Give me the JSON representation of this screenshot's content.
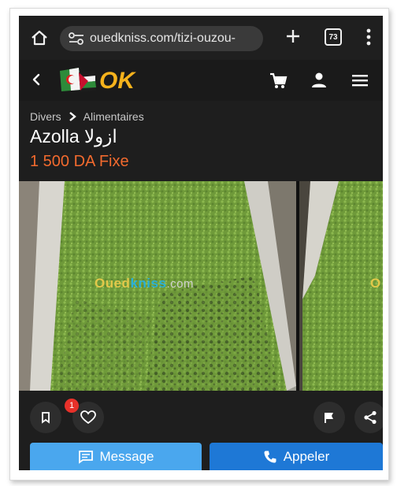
{
  "browser": {
    "url": "ouedkniss.com/tizi-ouzou-",
    "tab_count": "73"
  },
  "site": {
    "logo_text": "OK"
  },
  "listing": {
    "breadcrumb": [
      "Divers",
      "Alimentaires"
    ],
    "title": "Azolla ازولا",
    "price": "1 500 DA Fixe"
  },
  "gallery": {
    "watermark_part1": "Oued",
    "watermark_part2": "kniss",
    "watermark_part3": ".com",
    "watermark2_text": "O"
  },
  "actions": {
    "like_count": "1"
  },
  "cta": {
    "message_label": "Message",
    "call_label": "Appeler"
  },
  "colors": {
    "price": "#f26a2e",
    "message_button": "#4aa7ee",
    "call_button": "#1e78d6",
    "badge": "#e8312a"
  }
}
